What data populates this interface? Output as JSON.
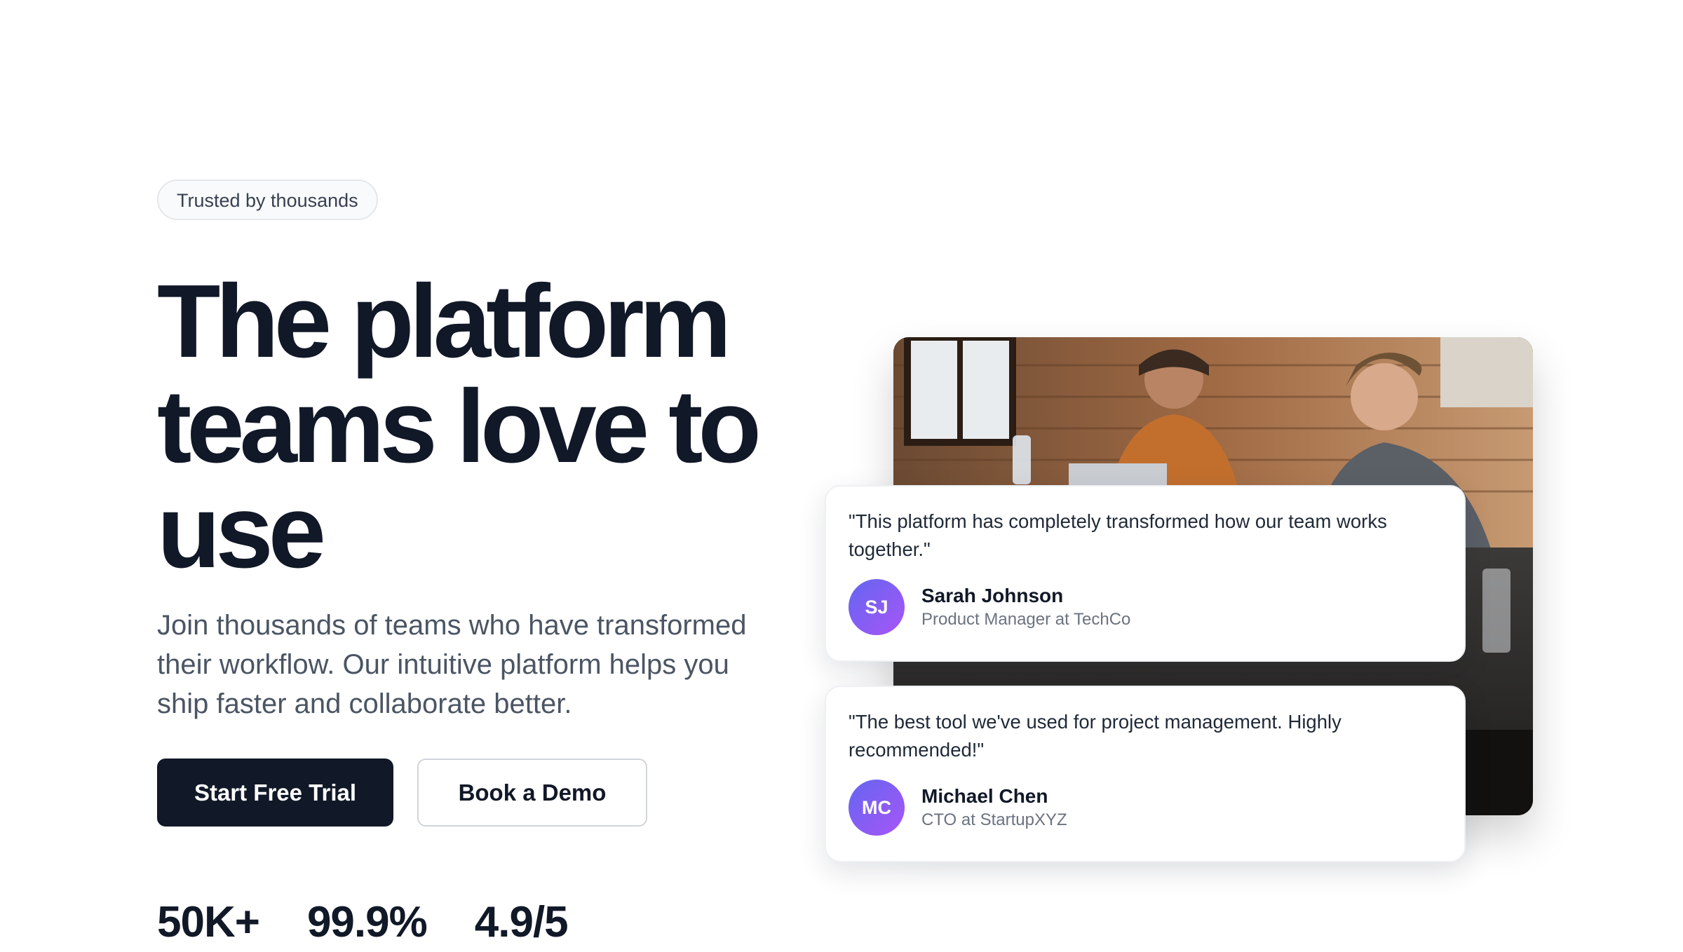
{
  "hero": {
    "badge": "Trusted by thousands",
    "headline": "The platform teams love to use",
    "subtext": "Join thousands of teams who have transformed their workflow. Our intuitive platform helps you ship faster and collaborate better.",
    "primary_cta": "Start Free Trial",
    "secondary_cta": "Book a Demo",
    "stats": [
      {
        "value": "50K+",
        "label": ""
      },
      {
        "value": "99.9%",
        "label": ""
      },
      {
        "value": "4.9/5",
        "label": ""
      }
    ]
  },
  "testimonials": [
    {
      "quote": "\"This platform has completely transformed how our team works together.\"",
      "initials": "SJ",
      "name": "Sarah Johnson",
      "role": "Product Manager at TechCo"
    },
    {
      "quote": "\"The best tool we've used for project management. Highly recommended!\"",
      "initials": "MC",
      "name": "Michael Chen",
      "role": "CTO at StartupXYZ"
    }
  ],
  "colors": {
    "primary": "#111827",
    "muted_text": "#4b5563",
    "avatar_gradient_start": "#6366f1",
    "avatar_gradient_end": "#a855f7"
  }
}
